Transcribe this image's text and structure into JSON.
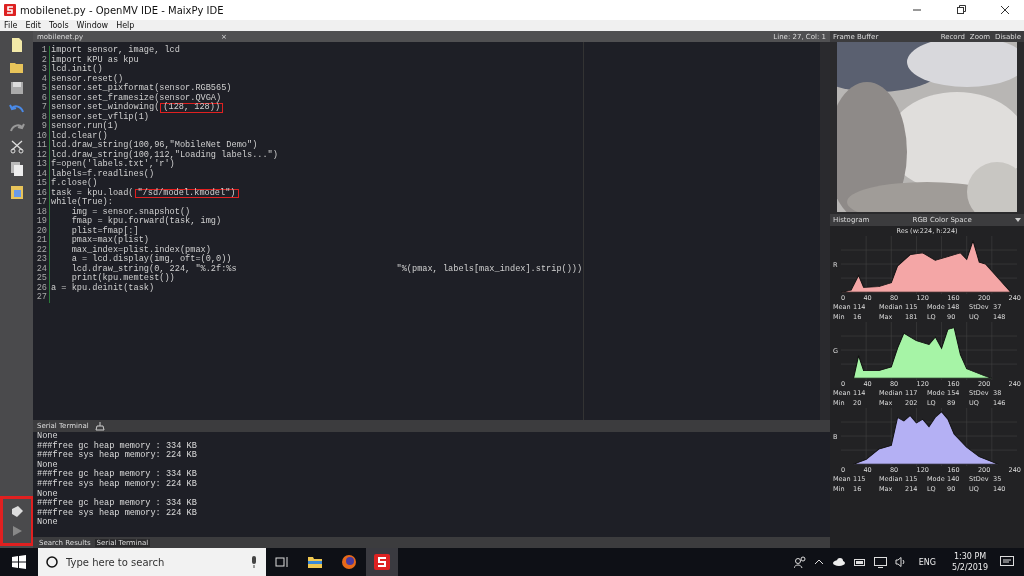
{
  "window": {
    "title": "mobilenet.py - OpenMV IDE - MaixPy IDE"
  },
  "menu": [
    "File",
    "Edit",
    "Tools",
    "Window",
    "Help"
  ],
  "toolbar": {
    "highlighted": true
  },
  "editor": {
    "tab": "mobilenet.py",
    "close": "×",
    "position": "Line: 27, Col: 1",
    "lines": [
      {
        "num": "1",
        "code": "import sensor, image, lcd"
      },
      {
        "num": "2",
        "code": "import KPU as kpu"
      },
      {
        "num": "3",
        "code": "lcd.init()"
      },
      {
        "num": "4",
        "code": "sensor.reset()"
      },
      {
        "num": "5",
        "code": "sensor.set_pixformat(sensor.RGB565)"
      },
      {
        "num": "6",
        "code": "sensor.set_framesize(sensor.QVGA)"
      },
      {
        "num": "7",
        "code": "sensor.set_windowing(",
        "marked": "(128, 128))"
      },
      {
        "num": "8",
        "code": "sensor.set_vflip(1)"
      },
      {
        "num": "9",
        "code": "sensor.run(1)"
      },
      {
        "num": "10",
        "code": "lcd.clear()"
      },
      {
        "num": "11",
        "code": "lcd.draw_string(100,96,\"MobileNet Demo\")"
      },
      {
        "num": "12",
        "code": "lcd.draw_string(100,112,\"Loading labels...\")"
      },
      {
        "num": "13",
        "code": "f=open('labels.txt','r')"
      },
      {
        "num": "14",
        "code": "labels=f.readlines()"
      },
      {
        "num": "15",
        "code": "f.close()"
      },
      {
        "num": "16",
        "code": "task = kpu.load(",
        "marked": "\"/sd/model.kmodel\")"
      },
      {
        "num": "17",
        "code": "while(True):"
      },
      {
        "num": "18",
        "code": "    img = sensor.snapshot()"
      },
      {
        "num": "19",
        "code": "    fmap = kpu.forward(task, img)"
      },
      {
        "num": "20",
        "code": "    plist=fmap[:]"
      },
      {
        "num": "21",
        "code": "    pmax=max(plist)"
      },
      {
        "num": "22",
        "code": "    max_index=plist.index(pmax)"
      },
      {
        "num": "23",
        "code": "    a = lcd.display(img, oft=(0,0))"
      },
      {
        "num": "24",
        "code": "    lcd.draw_string(0, 224, \"%.2f:%s                               \"%(pmax, labels[max_index].strip()))"
      },
      {
        "num": "25",
        "code": "    print(kpu.memtest())"
      },
      {
        "num": "26",
        "code": "a = kpu.deinit(task)"
      },
      {
        "num": "27"
      }
    ]
  },
  "terminal": {
    "title": "Serial Terminal",
    "lines": [
      "None",
      "###free gc heap memory : 334 KB",
      "###free sys heap memory: 224 KB",
      "None",
      "###free gc heap memory : 334 KB",
      "###free sys heap memory: 224 KB",
      "None",
      "###free gc heap memory : 334 KB",
      "###free sys heap memory: 224 KB",
      "None"
    ]
  },
  "bottom_tabs": [
    {
      "label": "Search Results",
      "selected": false
    },
    {
      "label": "Serial Terminal",
      "selected": true
    }
  ],
  "frame_buffer": {
    "title": "Frame Buffer",
    "buttons": [
      "Record",
      "Zoom",
      "Disable"
    ]
  },
  "histogram": {
    "title": "Histogram",
    "color_space": "RGB Color Space",
    "resolution": "Res (w:224, h:224)",
    "channels": [
      {
        "axis": "R",
        "color": "#f4a6a6",
        "x_ticks": [
          "0",
          "40",
          "80",
          "120",
          "160",
          "200",
          "240"
        ],
        "stats": [
          [
            [
              "Mean",
              "114"
            ],
            [
              "Median",
              "115"
            ],
            [
              "Mode",
              "148"
            ],
            [
              "StDev",
              "37"
            ]
          ],
          [
            [
              "Min",
              "16"
            ],
            [
              "Max",
              "181"
            ],
            [
              "LQ",
              "90"
            ],
            [
              "UQ",
              "148"
            ]
          ]
        ]
      },
      {
        "axis": "G",
        "color": "#a6f4a6",
        "x_ticks": [
          "0",
          "40",
          "80",
          "120",
          "160",
          "200",
          "240"
        ],
        "stats": [
          [
            [
              "Mean",
              "114"
            ],
            [
              "Median",
              "117"
            ],
            [
              "Mode",
              "154"
            ],
            [
              "StDev",
              "38"
            ]
          ],
          [
            [
              "Min",
              "20"
            ],
            [
              "Max",
              "202"
            ],
            [
              "LQ",
              "89"
            ],
            [
              "UQ",
              "146"
            ]
          ]
        ]
      },
      {
        "axis": "B",
        "color": "#b4b0f4",
        "x_ticks": [
          "0",
          "40",
          "80",
          "120",
          "160",
          "200",
          "240"
        ],
        "stats": [
          [
            [
              "Mean",
              "115"
            ],
            [
              "Median",
              "115"
            ],
            [
              "Mode",
              "140"
            ],
            [
              "StDev",
              "35"
            ]
          ],
          [
            [
              "Min",
              "16"
            ],
            [
              "Max",
              "214"
            ],
            [
              "LQ",
              "90"
            ],
            [
              "UQ",
              "140"
            ]
          ]
        ]
      }
    ]
  },
  "taskbar": {
    "search_placeholder": "Type here to search",
    "language": "ENG",
    "time": "1:30 PM",
    "date": "5/2/2019"
  }
}
